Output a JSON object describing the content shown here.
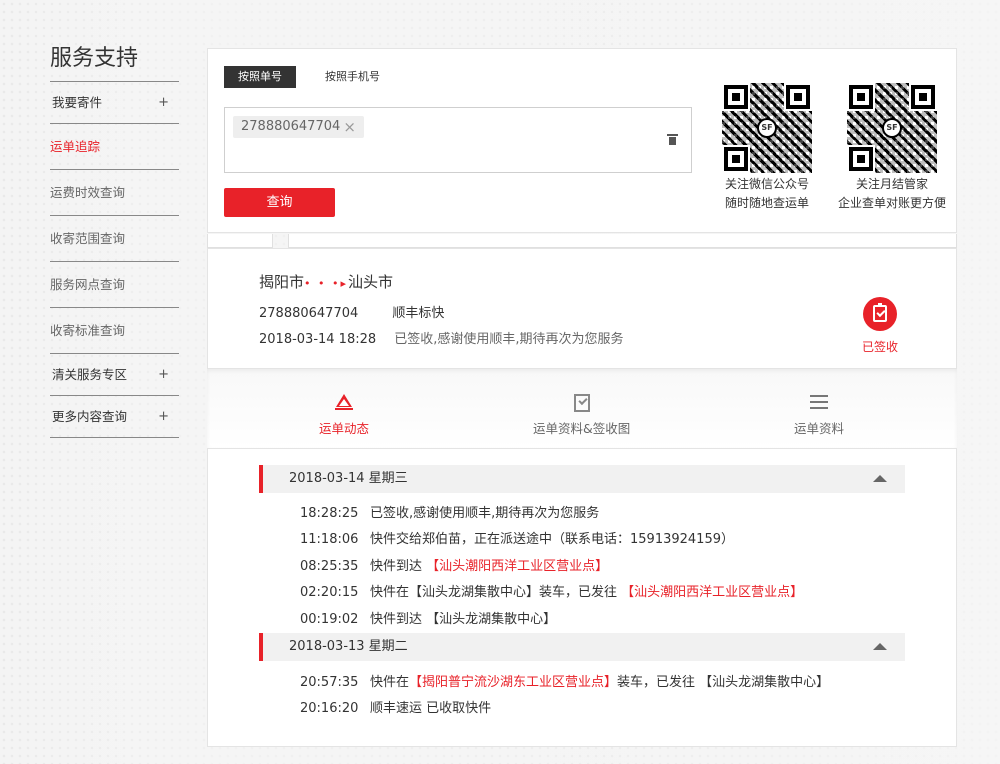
{
  "sidebar": {
    "title": "服务支持",
    "items": [
      {
        "label": "我要寄件",
        "plus": "+"
      },
      {
        "label": "运单追踪"
      },
      {
        "label": "运费时效查询"
      },
      {
        "label": "收寄范围查询"
      },
      {
        "label": "服务网点查询"
      },
      {
        "label": "收寄标准查询"
      },
      {
        "label": "清关服务专区",
        "plus": "+"
      },
      {
        "label": "更多内容查询",
        "plus": "+"
      }
    ]
  },
  "query": {
    "tab_active": "按照单号",
    "tab_other": "按照手机号",
    "chip_value": "278880647704",
    "chip_close": "×",
    "button": "查询",
    "qr1": {
      "line1": "关注微信公众号",
      "line2": "随时随地查运单",
      "logo": "SF"
    },
    "qr2": {
      "line1": "关注月结管家",
      "line2": "企业查单对账更方便",
      "logo": "SF"
    }
  },
  "result": {
    "origin": "揭阳市",
    "dots": "• • •",
    "arrow": "▸",
    "destination": "汕头市",
    "waybill": "278880647704",
    "service": "顺丰标快",
    "time": "2018-03-14 18:28",
    "latest": "已签收,感谢使用顺丰,期待再次为您服务",
    "status": "已签收",
    "tabs": [
      "运单动态",
      "运单资料&签收图",
      "运单资料"
    ],
    "days": [
      {
        "date": "2018-03-14 星期三",
        "events": [
          {
            "time": "18:28:25",
            "pre": "已签收,感谢使用顺丰,期待再次为您服务",
            "red": "",
            "mid": "",
            "red2": ""
          },
          {
            "time": "11:18:06",
            "pre": "快件交给郑伯苗，正在派送途中（联系电话：15913924159）",
            "red": "",
            "mid": "",
            "red2": ""
          },
          {
            "time": "08:25:35",
            "pre": "快件到达 ",
            "red": "【汕头潮阳西洋工业区营业点】",
            "mid": "",
            "red2": ""
          },
          {
            "time": "02:20:15",
            "pre": "快件在【汕头龙湖集散中心】装车，已发往 ",
            "red": "【汕头潮阳西洋工业区营业点】",
            "mid": "",
            "red2": ""
          },
          {
            "time": "00:19:02",
            "pre": "快件到达 【汕头龙湖集散中心】",
            "red": "",
            "mid": "",
            "red2": ""
          }
        ]
      },
      {
        "date": "2018-03-13 星期二",
        "events": [
          {
            "time": "20:57:35",
            "pre": "快件在",
            "red": "【揭阳普宁流沙湖东工业区营业点】",
            "mid": "装车，已发往 【汕头龙湖集散中心】",
            "red2": ""
          },
          {
            "time": "20:16:20",
            "pre": "顺丰速运 已收取快件",
            "red": "",
            "mid": "",
            "red2": ""
          }
        ]
      }
    ]
  },
  "colors": {
    "accent": "#e82229",
    "dark_tab": "#333333"
  }
}
